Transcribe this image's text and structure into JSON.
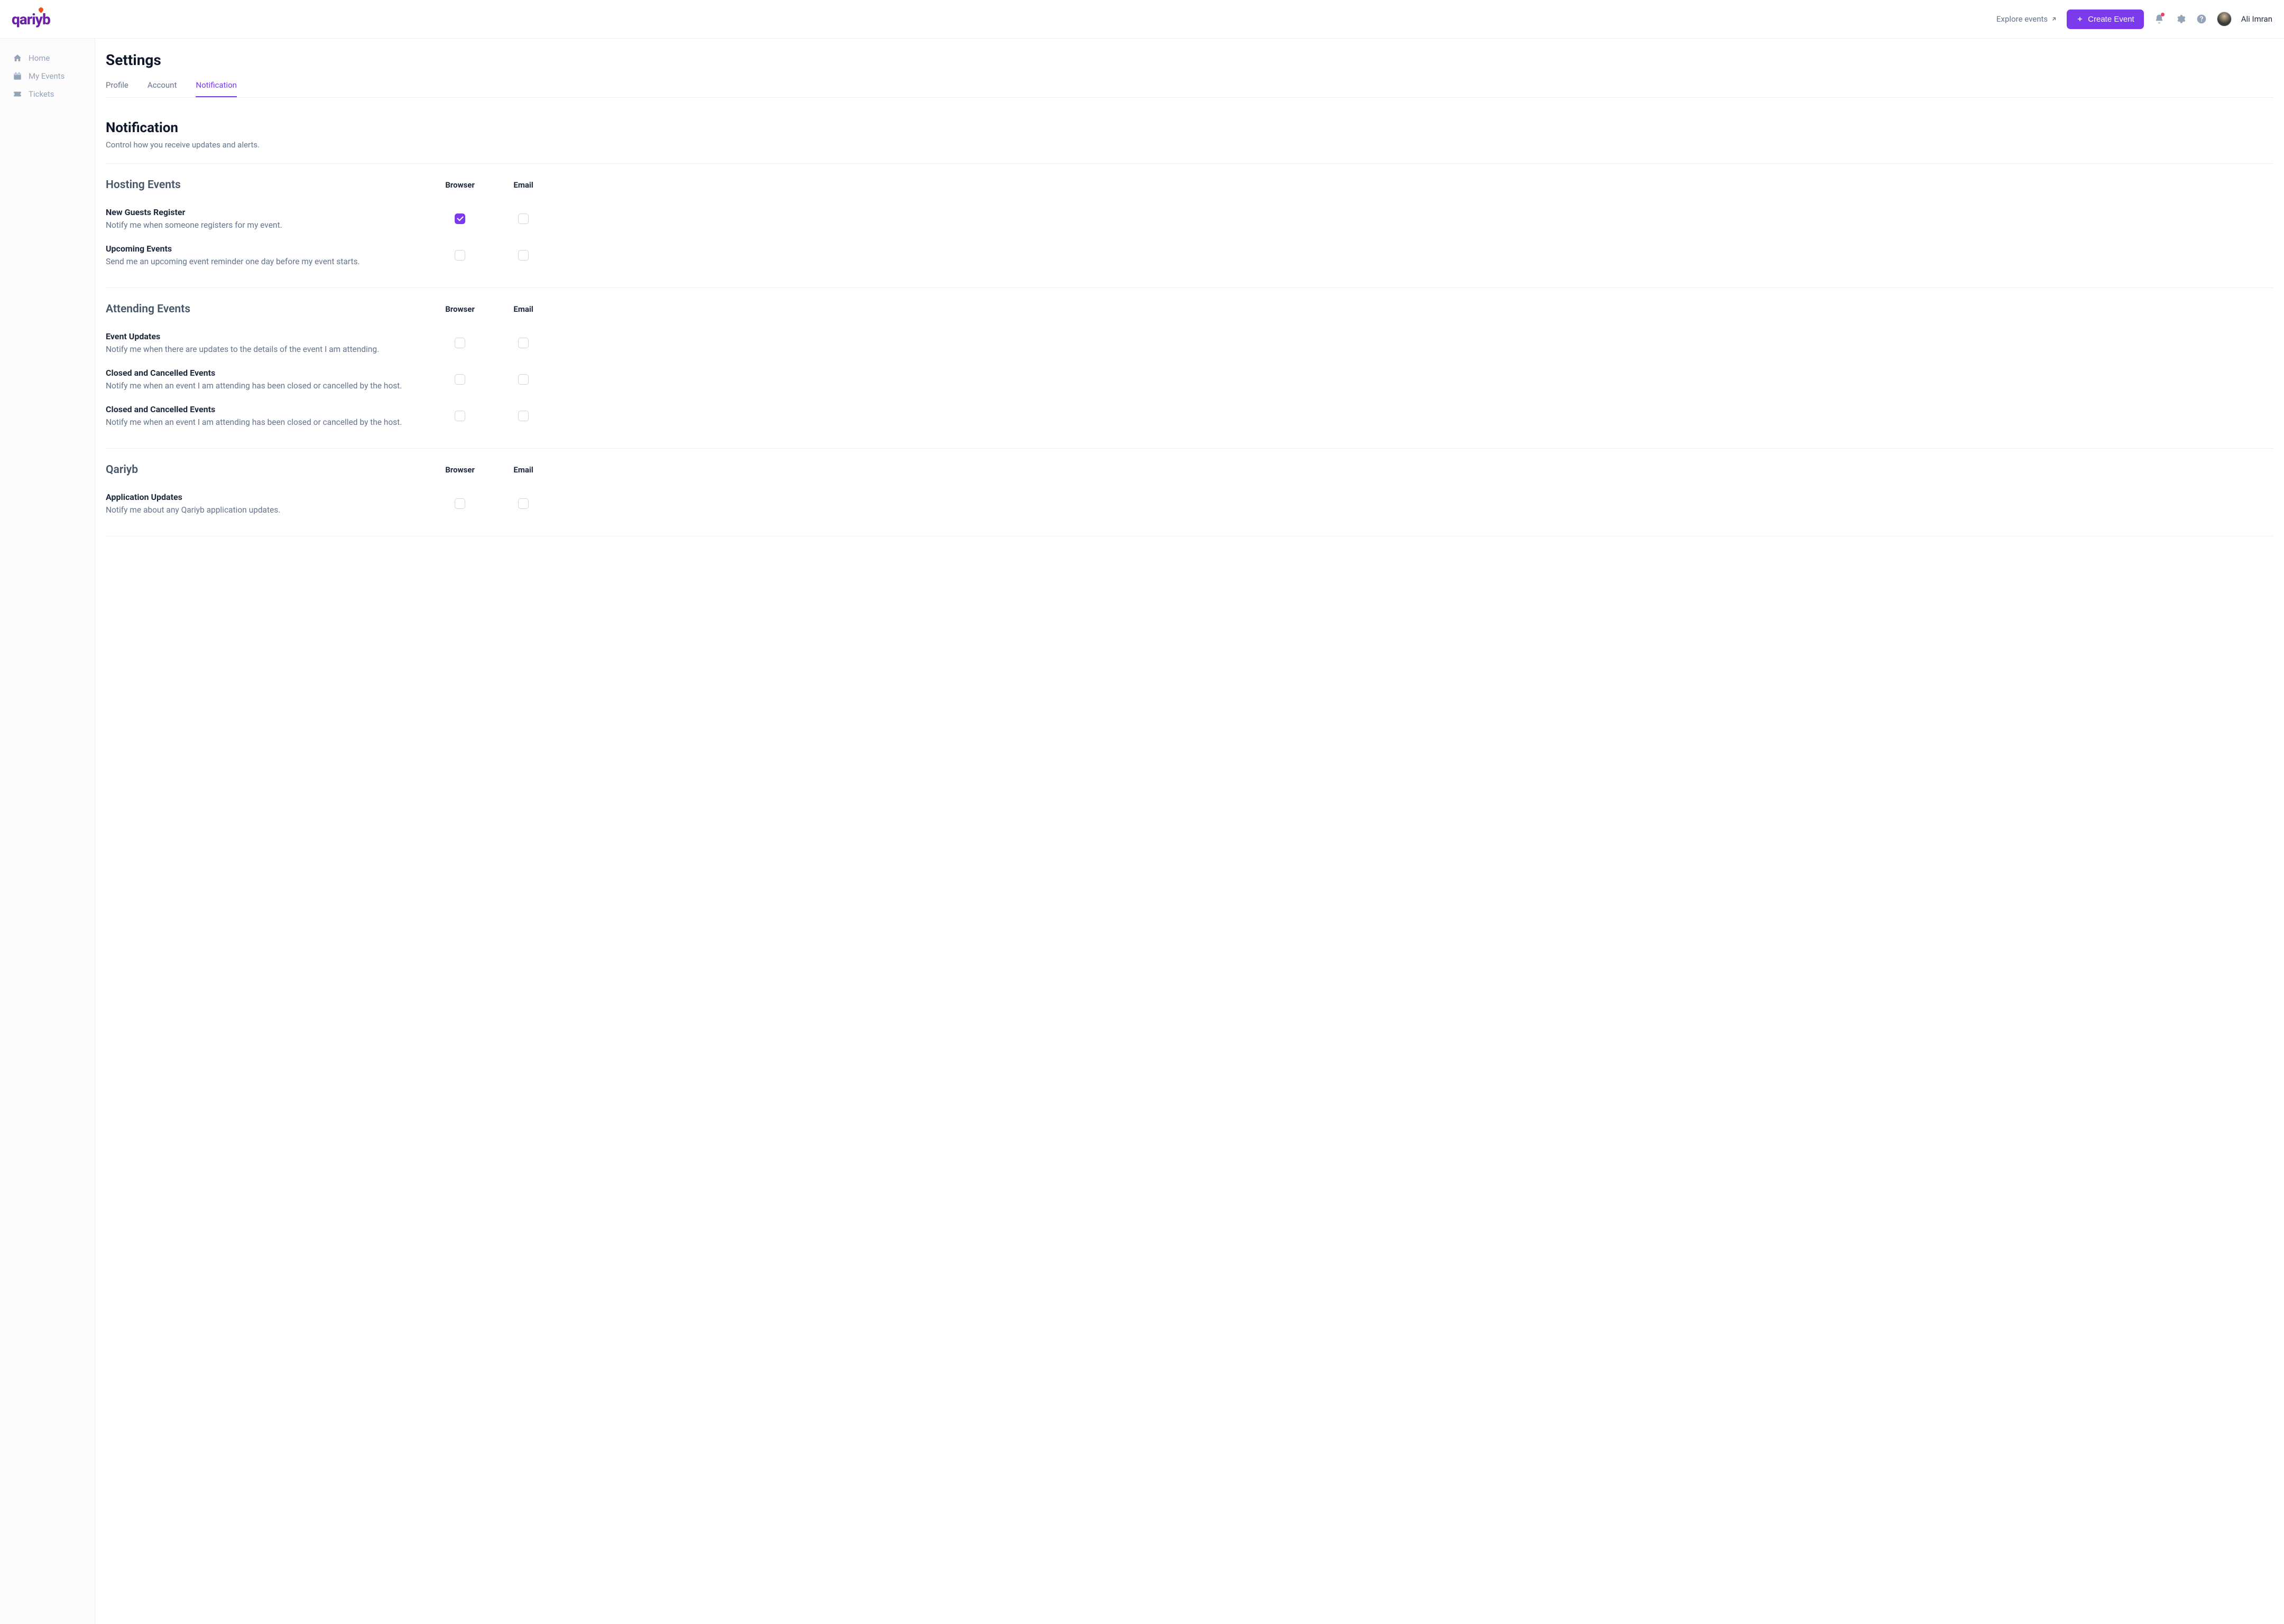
{
  "header": {
    "explore_label": "Explore events",
    "create_label": "Create Event",
    "user_name": "Ali Imran"
  },
  "sidebar": {
    "items": [
      {
        "label": "Home"
      },
      {
        "label": "My Events"
      },
      {
        "label": "Tickets"
      }
    ]
  },
  "page": {
    "title": "Settings"
  },
  "tabs": [
    {
      "label": "Profile",
      "active": false
    },
    {
      "label": "Account",
      "active": false
    },
    {
      "label": "Notification",
      "active": true
    }
  ],
  "section": {
    "title": "Notification",
    "subtitle": "Control how you receive updates and alerts."
  },
  "columns": {
    "browser": "Browser",
    "email": "Email"
  },
  "groups": [
    {
      "title": "Hosting Events",
      "rows": [
        {
          "title": "New Guests Register",
          "desc": "Notify me when someone registers for my event.",
          "browser": true,
          "email": false
        },
        {
          "title": "Upcoming Events",
          "desc": "Send me an upcoming event reminder one day before my event starts.",
          "browser": false,
          "email": false
        }
      ]
    },
    {
      "title": "Attending Events",
      "rows": [
        {
          "title": "Event Updates",
          "desc": "Notify me when there are updates to the details of the event I am attending.",
          "browser": false,
          "email": false
        },
        {
          "title": "Closed and Cancelled Events",
          "desc": "Notify me when an event I am attending has been closed or cancelled by the host.",
          "browser": false,
          "email": false
        },
        {
          "title": "Closed and Cancelled Events",
          "desc": "Notify me when an event I am attending has been closed or cancelled by the host.",
          "browser": false,
          "email": false
        }
      ]
    },
    {
      "title": "Qariyb",
      "rows": [
        {
          "title": "Application Updates",
          "desc": "Notify me about any Qariyb application updates.",
          "browser": false,
          "email": false
        }
      ]
    }
  ]
}
